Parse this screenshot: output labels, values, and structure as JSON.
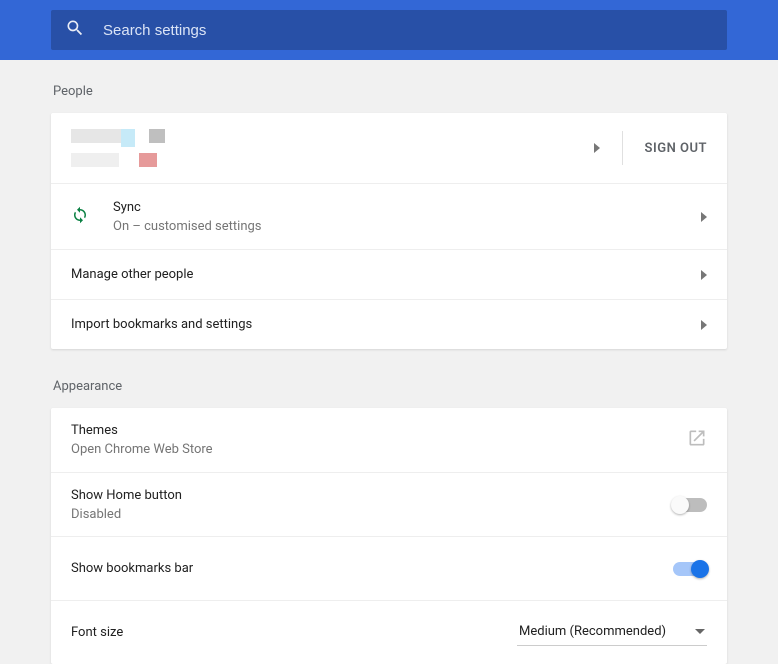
{
  "search": {
    "placeholder": "Search settings"
  },
  "sections": {
    "people": {
      "title": "People",
      "signout": "SIGN OUT",
      "sync": {
        "title": "Sync",
        "subtitle": "On – customised settings"
      },
      "manage": "Manage other people",
      "import": "Import bookmarks and settings"
    },
    "appearance": {
      "title": "Appearance",
      "themes": {
        "title": "Themes",
        "subtitle": "Open Chrome Web Store"
      },
      "home": {
        "title": "Show Home button",
        "subtitle": "Disabled"
      },
      "bookmarks": "Show bookmarks bar",
      "fontsize": {
        "label": "Font size",
        "value": "Medium (Recommended)"
      }
    }
  }
}
